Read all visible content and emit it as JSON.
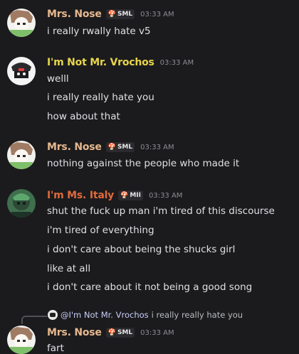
{
  "colors": {
    "background": "#1b1b1d",
    "mrs_nose": "#e5b88e",
    "mr_vrochos": "#e7d64b",
    "ms_italy": "#e06a3b",
    "mention": "#c9cdfb"
  },
  "messages": [
    {
      "username": "Mrs. Nose",
      "tag_icon": "mushroom-icon",
      "tag": "SML",
      "time": "03:33 AM",
      "lines": [
        "i really rwally hate v5"
      ]
    },
    {
      "username": "I'm Not Mr. Vrochos",
      "time": "03:33 AM",
      "lines": [
        "welll",
        "i really really hate you",
        "how about that"
      ]
    },
    {
      "username": "Mrs. Nose",
      "tag_icon": "mushroom-icon",
      "tag": "SML",
      "time": "03:33 AM",
      "lines": [
        "nothing against  the people who made it"
      ]
    },
    {
      "username": "I'm Ms. Italy",
      "tag_icon": "mushroom-icon",
      "tag": "MII",
      "time": "03:33 AM",
      "lines": [
        "shut the fuck up man i'm tired of this discourse",
        "i'm tired of everything",
        "i don't care about being the shucks girl",
        "like at all",
        "i don't care about it not being a good song"
      ]
    },
    {
      "reply": {
        "mention": "@I'm Not Mr. Vrochos",
        "text": "i really really hate you"
      },
      "username": "Mrs. Nose",
      "tag_icon": "mushroom-icon",
      "tag": "SML",
      "time": "03:33 AM",
      "lines": [
        "fart"
      ]
    }
  ]
}
